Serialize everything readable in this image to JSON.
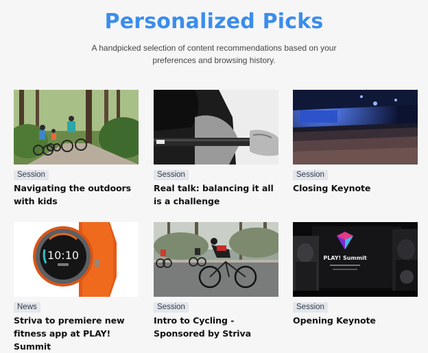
{
  "header": {
    "title": "Personalized Picks",
    "subtitle": "A handpicked selection of content recommendations based on your preferences and browsing history."
  },
  "cards": [
    {
      "badge": "Session",
      "title": "Navigating the outdoors with kids",
      "image": "family-cycling-forest"
    },
    {
      "badge": "Session",
      "title": "Real talk: balancing it all is a challenge",
      "image": "barbell-lifter-bw"
    },
    {
      "badge": "Session",
      "title": "Closing Keynote",
      "image": "keynote-audience-stage"
    },
    {
      "badge": "News",
      "title": "Striva to premiere new fitness app at PLAY! Summit",
      "image": "orange-smartwatch",
      "watch_time": "10:10"
    },
    {
      "badge": "Session",
      "title": "Intro to Cycling - Sponsored by Striva",
      "image": "road-cyclists"
    },
    {
      "badge": "Session",
      "title": "Opening Keynote",
      "image": "play-summit-stage",
      "screen_brand": "PLAY! Summit"
    }
  ],
  "colors": {
    "accent": "#3b8ded",
    "badge_bg": "#e4e6ea",
    "page_bg": "#f6f6f7"
  }
}
